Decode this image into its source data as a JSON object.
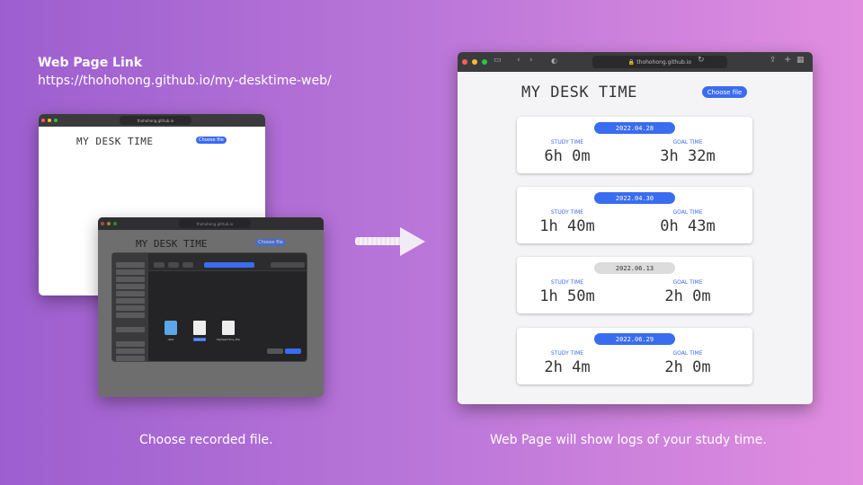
{
  "header": {
    "title": "Web Page Link",
    "url": "https://thohohong.github.io/my-desktime-web/"
  },
  "browser": {
    "address": "thohohong.github.io"
  },
  "app": {
    "title": "MY DESK TIME",
    "choose_file": "Choose file"
  },
  "dialog": {
    "files": [
      {
        "name": "data",
        "kind": "folder"
      },
      {
        "name": "data.txt",
        "kind": "doc"
      },
      {
        "name": "MyDeskTime_File",
        "kind": "doc"
      }
    ]
  },
  "captions": {
    "left": "Choose recorded file.",
    "right": "Web Page will show logs of your study time."
  },
  "logs": [
    {
      "date": "2022.04.28",
      "study_label": "STUDY TIME",
      "study": "6h 0m",
      "goal_label": "GOAL TIME",
      "goal": "3h 32m",
      "highlight": true
    },
    {
      "date": "2022.04.30",
      "study_label": "STUDY TIME",
      "study": "1h 40m",
      "goal_label": "GOAL TIME",
      "goal": "0h 43m",
      "highlight": true
    },
    {
      "date": "2022.06.13",
      "study_label": "STUDY TIME",
      "study": "1h 50m",
      "goal_label": "GOAL TIME",
      "goal": "2h 0m",
      "highlight": false
    },
    {
      "date": "2022.06.29",
      "study_label": "STUDY TIME",
      "study": "2h 4m",
      "goal_label": "GOAL TIME",
      "goal": "2h 0m",
      "highlight": true
    }
  ],
  "colors": {
    "accent": "#3a6cf0",
    "pill_gray": "#dcdcdc"
  }
}
